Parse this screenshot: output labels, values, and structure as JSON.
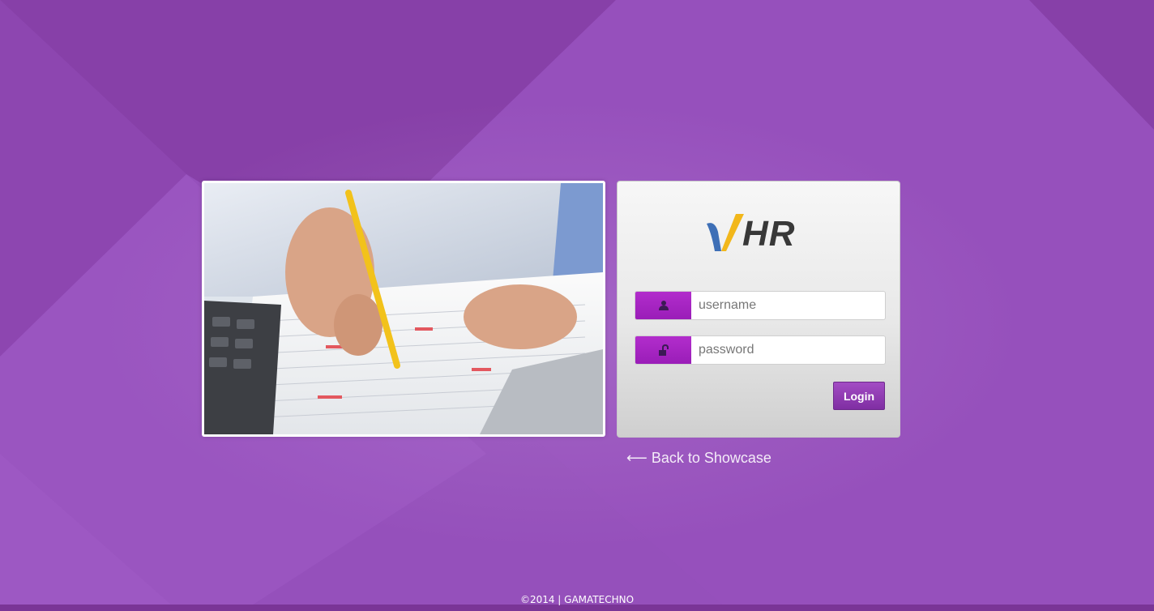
{
  "colors": {
    "background": "#9550bb",
    "accent": "#9a1db8",
    "button": "#8a35ad"
  },
  "hero_image": {
    "icon": "office-accounting-photo"
  },
  "login": {
    "logo_text": "HR",
    "username_placeholder": "username",
    "password_placeholder": "password",
    "username_icon": "user-icon",
    "password_icon": "unlock-icon",
    "login_label": "Login"
  },
  "back_link": {
    "arrow": "⟵",
    "label": "Back to Showcase"
  },
  "footer": {
    "text": "©2014 | GAMATECHNO"
  }
}
